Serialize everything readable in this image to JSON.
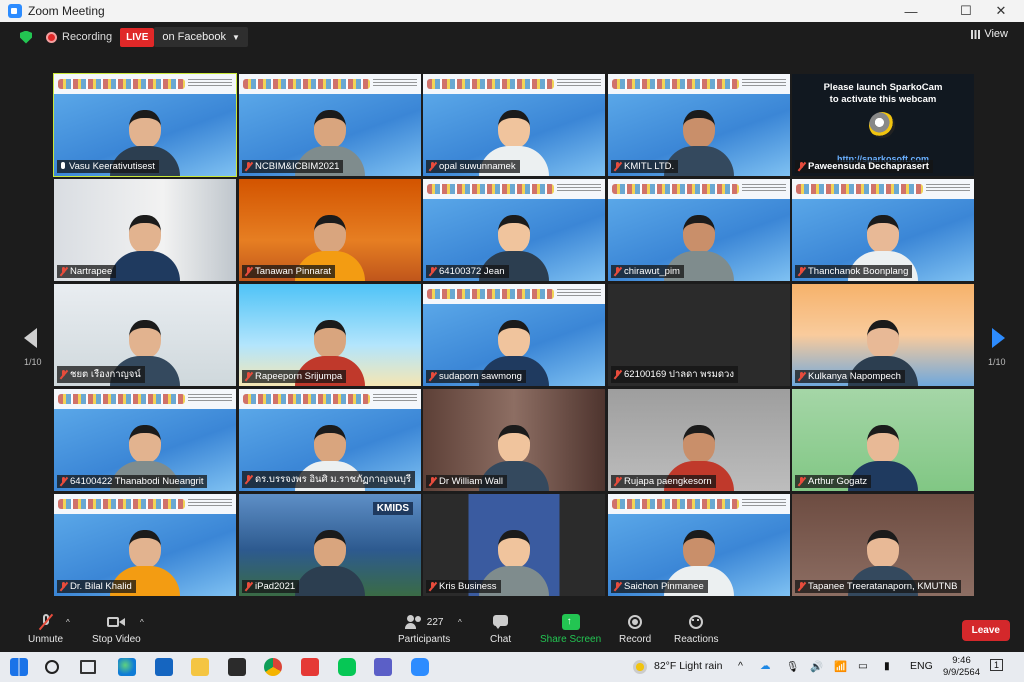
{
  "window": {
    "title": "Zoom Meeting"
  },
  "topbar": {
    "recording_label": "Recording",
    "live_label": "LIVE",
    "live_target": "on Facebook",
    "view_label": "View"
  },
  "pagination": {
    "left": "1/10",
    "right": "1/10"
  },
  "sparkocam": {
    "line1": "Please launch SparkoCam",
    "line2": "to activate this webcam",
    "url": "http://sparkosoft.com"
  },
  "participants": [
    {
      "name": "Vasu Keerativutisest",
      "muted": false,
      "active": true,
      "scene": "slide"
    },
    {
      "name": "NCBIM&ICBIM2021",
      "muted": true,
      "scene": "slide"
    },
    {
      "name": "opal suwunnamek",
      "muted": true,
      "scene": "slide"
    },
    {
      "name": "KMITL LTD.",
      "muted": true,
      "scene": "slide"
    },
    {
      "name": "Paweensuda Dechaprasert",
      "muted": true,
      "scene": "sparko"
    },
    {
      "name": "Nartrapee",
      "muted": true,
      "scene": "office"
    },
    {
      "name": "Tanawan Pinnarat",
      "muted": true,
      "scene": "orange"
    },
    {
      "name": "64100372 Jean",
      "muted": true,
      "scene": "slide"
    },
    {
      "name": "chirawut_pim",
      "muted": true,
      "scene": "slide"
    },
    {
      "name": "Thanchanok Boonplang",
      "muted": true,
      "scene": "slide"
    },
    {
      "name": "ชยต เรืองกาญจน์",
      "muted": true,
      "scene": "lab"
    },
    {
      "name": "Rapeeporn Srijumpa",
      "muted": true,
      "scene": "tropical"
    },
    {
      "name": "sudaporn sawmong",
      "muted": true,
      "scene": "slide"
    },
    {
      "name": "62100169 ปาลดา พรมดวง",
      "muted": true,
      "scene": "blank"
    },
    {
      "name": "Kulkanya Napompech",
      "muted": true,
      "scene": "bridge"
    },
    {
      "name": "64100422 Thanabodi Nueangrit",
      "muted": true,
      "scene": "slide"
    },
    {
      "name": "ดร.บรรจงพร อินศิ ม.ราชภัฏกาญจนบุรี",
      "muted": true,
      "scene": "slide"
    },
    {
      "name": "Dr William Wall",
      "muted": true,
      "scene": "shelf"
    },
    {
      "name": "Rujapa paengkesorn",
      "muted": true,
      "scene": "gray"
    },
    {
      "name": "Arthur Gogatz",
      "muted": true,
      "scene": "green"
    },
    {
      "name": "Dr. Bilal Khalid",
      "muted": true,
      "scene": "slide"
    },
    {
      "name": "iPad2021",
      "muted": true,
      "scene": "kmids"
    },
    {
      "name": "Kris Business",
      "muted": true,
      "scene": "suit"
    },
    {
      "name": "Saichon Pinmanee",
      "muted": true,
      "scene": "slide"
    },
    {
      "name": "Tapanee Treeratanaporn, KMUTNB",
      "muted": true,
      "scene": "sofa"
    }
  ],
  "kmids_label": "KMIDS",
  "toolbar": {
    "unmute": "Unmute",
    "stop_video": "Stop Video",
    "participants_count": "227",
    "participants": "Participants",
    "chat": "Chat",
    "share_screen": "Share Screen",
    "record": "Record",
    "reactions": "Reactions",
    "leave": "Leave"
  },
  "taskbar": {
    "weather": "82°F  Light rain",
    "lang": "ENG",
    "time": "9:46",
    "date": "9/9/2564",
    "notifications": "1"
  }
}
